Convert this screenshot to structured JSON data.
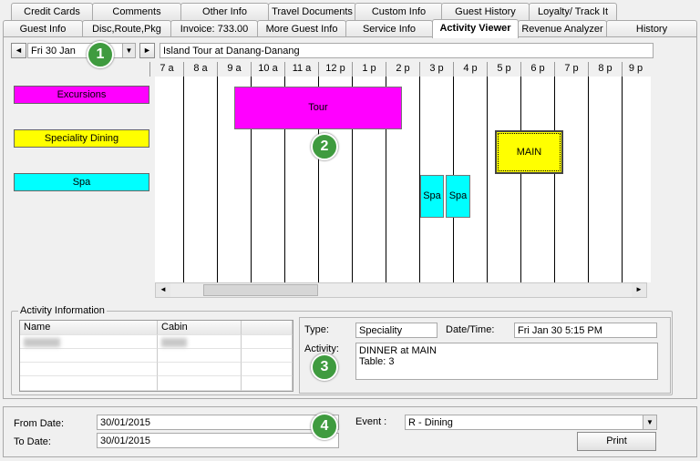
{
  "tabs_row1": [
    "Credit Cards",
    "Comments",
    "Other Info",
    "Travel Documents",
    "Custom Info",
    "Guest History",
    "Loyalty/ Track It"
  ],
  "tabs_row2": [
    "Guest Info",
    "Disc,Route,Pkg",
    "Invoice: 733.00",
    "More Guest Info",
    "Service Info",
    "Activity Viewer",
    "Revenue Analyzer",
    "History"
  ],
  "active_tab": "Activity Viewer",
  "date_nav": {
    "selected_date": "Fri 30 Jan",
    "prev_glyph": "◄",
    "next_glyph": "►",
    "dropdown_glyph": "▼"
  },
  "activity_title": "Island Tour at Danang-Danang",
  "hours": [
    "7 a",
    "8 a",
    "9 a",
    "10 a",
    "11 a",
    "12 p",
    "1 p",
    "2 p",
    "3 p",
    "4 p",
    "5 p",
    "6 p",
    "7 p",
    "8 p",
    "9 p"
  ],
  "legend": [
    {
      "label": "Excursions",
      "color": "#ff00ff"
    },
    {
      "label": "Speciality Dining",
      "color": "#ffff00"
    },
    {
      "label": "Spa",
      "color": "#00ffff"
    }
  ],
  "events": {
    "tour": "Tour",
    "main": "MAIN",
    "spa1": "Spa",
    "spa2": "Spa"
  },
  "scroll": {
    "left": "◄",
    "right": "►"
  },
  "activity_info": {
    "group_label": "Activity Information",
    "col_name": "Name",
    "col_cabin": "Cabin",
    "type_label": "Type:",
    "type_value": "Speciality",
    "datetime_label": "Date/Time:",
    "datetime_value": "Fri Jan 30 5:15 PM",
    "activity_label": "Activity:",
    "activity_line1": "DINNER at MAIN",
    "activity_line2": "Table: 3"
  },
  "filter": {
    "from_label": "From Date:",
    "from_value": "30/01/2015",
    "to_label": "To Date:",
    "to_value": "30/01/2015",
    "event_label": "Event :",
    "event_value": "R - Dining",
    "print_label": "Print"
  },
  "badges": [
    "1",
    "2",
    "3",
    "4"
  ],
  "colors": {
    "excursion": "#ff00ff",
    "dining": "#ffff00",
    "spa": "#00ffff",
    "badge": "#3f9b3f"
  }
}
